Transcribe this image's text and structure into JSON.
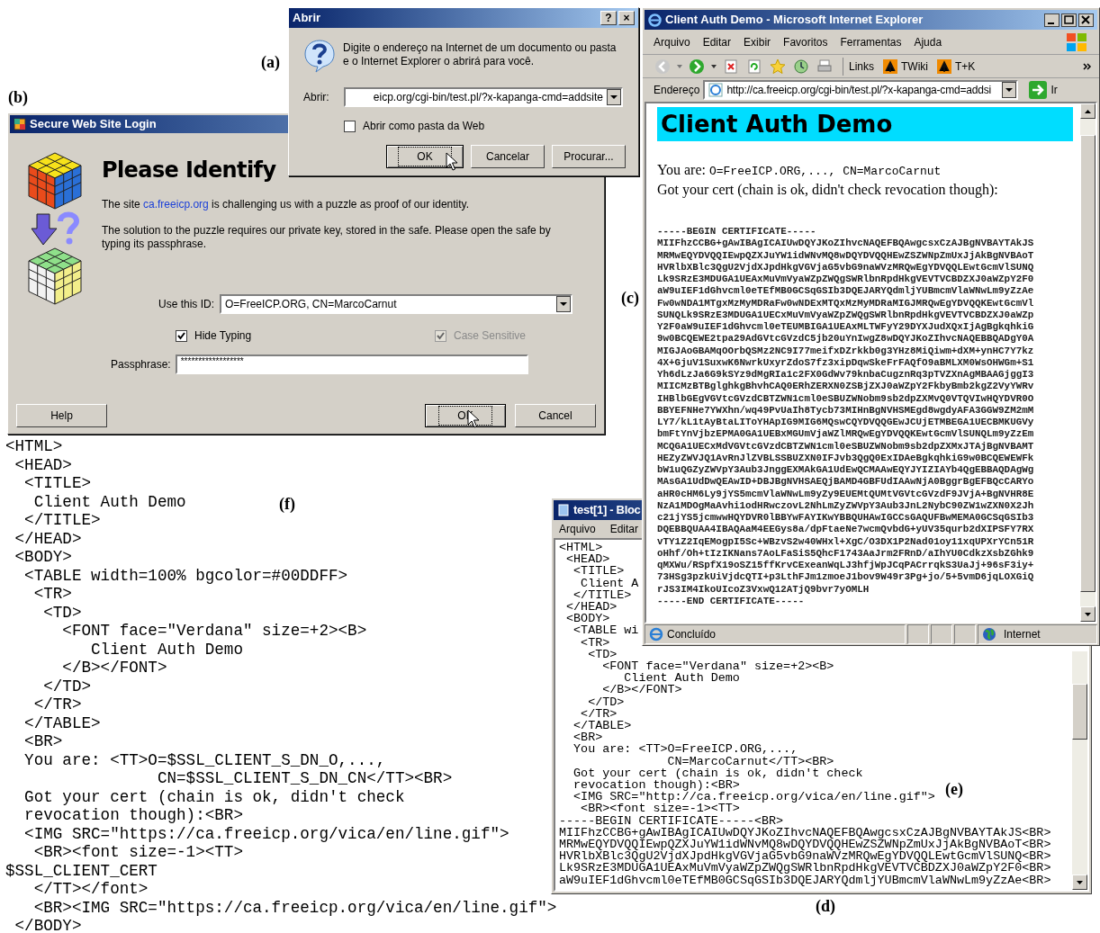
{
  "panel_labels": [
    "(a)",
    "(b)",
    "(c)",
    "(d)",
    "(e)",
    "(f)"
  ],
  "open_dialog": {
    "title": "Abrir",
    "title_buttons": [
      "?",
      "×"
    ],
    "message": "Digite o endereço na Internet de um documento ou pasta e o Internet Explorer o abrirá para você.",
    "field_label": "Abrir:",
    "address": "eicp.org/cgi-bin/test.pl/?x-kapanga-cmd=addsite",
    "checkbox": {
      "label": "Abrir como pasta da Web",
      "checked": false
    },
    "buttons": [
      {
        "label": "OK",
        "default": true
      },
      {
        "label": "Cancelar",
        "default": false
      },
      {
        "label": "Procurar...",
        "default": false
      }
    ]
  },
  "login_dialog": {
    "title": "Secure Web Site Login",
    "heading": "Please Identify",
    "intro": {
      "before": "The site ",
      "link": "ca.freeicp.org",
      "after": " is challenging us with a puzzle as proof of our identity."
    },
    "paragraph": "The solution to the puzzle requires our private key, stored in the safe. Please open the safe by typing its passphrase.",
    "id_label": "Use this ID:",
    "id_value": "O=FreeICP.ORG, CN=MarcoCarnut",
    "options": [
      {
        "label": "Hide Typing",
        "checked": true,
        "disabled": false
      },
      {
        "label": "Case Sensitive",
        "checked": true,
        "disabled": true
      }
    ],
    "passphrase_label": "Passphrase:",
    "passphrase": "******************",
    "buttons": [
      {
        "label": "Help",
        "default": false
      },
      {
        "label": "OK",
        "default": true
      },
      {
        "label": "Cancel",
        "default": false
      }
    ]
  },
  "browser": {
    "title": "Client Auth Demo - Microsoft Internet Explorer",
    "menu": [
      "Arquivo",
      "Editar",
      "Exibir",
      "Favoritos",
      "Ferramentas",
      "Ajuda"
    ],
    "links_label": "Links",
    "links": [
      "TWiki",
      "T+K"
    ],
    "address_label": "Endereço",
    "address": "http://ca.freeicp.org/cgi-bin/test.pl/?x-kapanga-cmd=addsi",
    "go": "Ir",
    "page": {
      "banner": "Client Auth Demo",
      "you_are_label": "You are:",
      "you_are_value": "O=FreeICP.ORG,..., CN=MarcoCarnut",
      "cert_note": "Got your cert (chain is ok, didn't check revocation though):",
      "certificate": [
        "-----BEGIN CERTIFICATE-----",
        "MIIFhzCCBG+gAwIBAgICAIUwDQYJKoZIhvcNAQEFBQAwgcsxCzAJBgNVBAYTAkJS",
        "MRMwEQYDVQQIEwpQZXJuYW1idWNvMQ8wDQYDVQQHEwZSZWNpZmUxJjAkBgNVBAoT",
        "HVRlbXBlc3QgU2VjdXJpdHkgVGVjaG5vbG9naWVzMRQwEgYDVQQLEwtGcmVlSUNQ",
        "Lk9SRzE3MDUGA1UEAxMuVmVyaWZpZWQgSWRlbnRpdHkgVEVTVCBDZXJ0aWZpY2F0",
        "aW9uIEF1dGhvcml0eTEfMB0GCSqGSIb3DQEJARYQdmljYUBmcmVlaWNwLm9yZzAe",
        "Fw0wNDA1MTgxMzMyMDRaFw0wNDExMTQxMzMyMDRaMIGJMRQwEgYDVQQKEwtGcmVl",
        "SUNQLk9SRzE3MDUGA1UECxMuVmVyaWZpZWQgSWRlbnRpdHkgVEVTVCBDZXJ0aWZp",
        "Y2F0aW9uIEF1dGhvcml0eTEUMBIGA1UEAxMLTWFyY29DYXJudXQxIjAgBgkqhkiG",
        "9w0BCQEWE2tpa29AdGVtcGVzdC5jb20uYnIwgZ8wDQYJKoZIhvcNAQEBBQADgY0A",
        "MIGJAoGBAMqOOrbQSMz2NC9I77meifxDZrkkb0g3YHz8MiQiwm+dXM+ynHC7Y7kz",
        "4X+GjuV1SuxwK6NwrkUxyrZdoS7fz3xipDqwSkeFrFAQfO9aBMLXM0WsOHWGm+S1",
        "Yh6dLzJa6G9kSYz9dMgRIa1c2FX0GdWv79knbaCugznRq3pTVZXnAgMBAAGjggI3",
        "MIICMzBTBglghkgBhvhCAQ0ERhZERXN0ZSBjZXJ0aWZpY2FkbyBmb2kgZ2VyYWRv",
        "IHBlbGEgVGVtcGVzdCBTZWN1cml0eSBUZWNobm9sb2dpZXMvQ0VTQVIwHQYDVR0O",
        "BBYEFNHe7YWXhn/wq49PvUaIh8Tycb73MIHnBgNVHSMEgd8wgdyAFA3GGW9ZM2mM",
        "LY7/kL1tAyBtaLIToYHApIG9MIG6MQswCQYDVQQGEwJCUjETMBEGA1UECBMKUGVy",
        "bmFtYnVjbzEPMA0GA1UEBxMGUmVjaWZlMRQwEgYDVQQKEwtGcmVlSUNQLm9yZzEm",
        "MCQGA1UECxMdVGVtcGVzdCBTZWN1cml0eSBUZWNobm9sb2dpZXMxJTAjBgNVBAMT",
        "HEZyZWVJQ1AvRnJlZVBLSSBUZXN0IFJvb3QgQ0ExIDAeBgkqhkiG9w0BCQEWEWFk",
        "bW1uQGZyZWVpY3Aub3JnggEXMAkGA1UdEwQCMAAwEQYJYIZIAYb4QgEBBAQDAgWg",
        "MAsGA1UdDwQEAwID+DBJBgNVHSAEQjBAMD4GBFUdIAAwNjA0BggrBgEFBQcCARYo",
        "aHR0cHM6Ly9jYS5mcmVlaWNwLm9yZy9EUEMtQUMtVGVtcGVzdF9JVjA+BgNVHR8E",
        "NzA1MDOgMaAvhi1odHRwczovL2NhLmZyZWVpY3Aub3JnL2NybC90ZW1wZXN0X2Jh",
        "c21jYS5jcmwwHQYDVR0lBBYwFAYIKwYBBQUHAwIGCCsGAQUFBwMEMA0GCSqGSIb3",
        "DQEBBQUAA4IBAQAaM4EEGys8a/dpFtaeNe7wcmQvbdG+yUV35qurb2dXIPSFY7RX",
        "vTY1Z2IqEMogpI5Sc+WBzvS2w40WHxl+XgC/O3DX1P2Nad01oy11xqUPXrYCn51R",
        "oHhf/Oh+tIzIKNans7AoLFaSiS5QhcF1743AaJrm2FRnD/aIhYU0CdkzXsbZGhk9",
        "qMXWu/RSpfX19oSZ15ffKrvCExeanWqLJ3hfjWpJCqPACrrqkS3UaJj+96sF3iy+",
        "73HSg3pzkUiVjdcQTI+p3LthFJm1zmoeJ1bov9W49r3Pg+jo/5+5vmD6jqLOXGiQ",
        "rJS3IM4IkoUIcoZ3VxwQ12ATjQ9bvr7yOMLH",
        "-----END CERTIFICATE-----"
      ]
    },
    "status": "Concluído",
    "zone": "Internet"
  },
  "notepad": {
    "title": "test[1] - Bloc",
    "menu": [
      "Arquivo",
      "Editar"
    ],
    "lines": [
      "<HTML>",
      " <HEAD>",
      "  <TITLE>",
      "   Client A",
      "  </TITLE>",
      " </HEAD>",
      " <BODY>",
      "  <TABLE wi",
      "   <TR>",
      "    <TD>",
      "      <FONT face=\"Verdana\" size=+2><B>",
      "         Client Auth Demo",
      "      </B></FONT>",
      "    </TD>",
      "   </TR>",
      "  </TABLE>",
      "  <BR>",
      "  You are: <TT>O=FreeICP.ORG,...,",
      "               CN=MarcoCarnut</TT><BR>",
      "  Got your cert (chain is ok, didn't check",
      "  revocation though):<BR>",
      "  <IMG SRC=\"http://ca.freeicp.org/vica/en/line.gif\">",
      "   <BR><font size=-1><TT>",
      "-----BEGIN CERTIFICATE-----<BR>",
      "MIIFhzCCBG+gAwIBAgICAIUwDQYJKoZIhvcNAQEFBQAwgcsxCzAJBgNVBAYTAkJS<BR>",
      "MRMwEQYDVQQIEwpQZXJuYW1idWNvMQ8wDQYDVQQHEwZSZWNpZmUxJjAkBgNVBAoT<BR>",
      "HVRlbXBlc3QgU2VjdXJpdHkgVGVjaG5vbG9naWVzMRQwEgYDVQQLEwtGcmVlSUNQ<BR>",
      "Lk9SRzE3MDUGA1UEAxMuVmVyaWZpZWQgSWRlbnRpdHkgVEVTVCBDZXJ0aWZpY2F0<BR>",
      "aW9uIEF1dGhvcml0eTEfMB0GCSqGSIb3DQEJARYQdmljYUBmcmVlaWNwLm9yZzAe<BR>"
    ]
  },
  "source_code": {
    "lines": [
      "<HTML>",
      " <HEAD>",
      "  <TITLE>",
      "   Client Auth Demo",
      "  </TITLE>",
      " </HEAD>",
      " <BODY>",
      "  <TABLE width=100% bgcolor=#00DDFF>",
      "   <TR>",
      "    <TD>",
      "      <FONT face=\"Verdana\" size=+2><B>",
      "         Client Auth Demo",
      "      </B></FONT>",
      "    </TD>",
      "   </TR>",
      "  </TABLE>",
      "  <BR>",
      "  You are: <TT>O=$SSL_CLIENT_S_DN_O,...,",
      "                CN=$SSL_CLIENT_S_DN_CN</TT><BR>",
      "  Got your cert (chain is ok, didn't check",
      "  revocation though):<BR>",
      "  <IMG SRC=\"https://ca.freeicp.org/vica/en/line.gif\">",
      "   <BR><font size=-1><TT>",
      "$SSL_CLIENT_CERT",
      "   </TT></font>",
      "   <BR><IMG SRC=\"https://ca.freeicp.org/vica/en/line.gif\">",
      " </BODY>"
    ]
  }
}
